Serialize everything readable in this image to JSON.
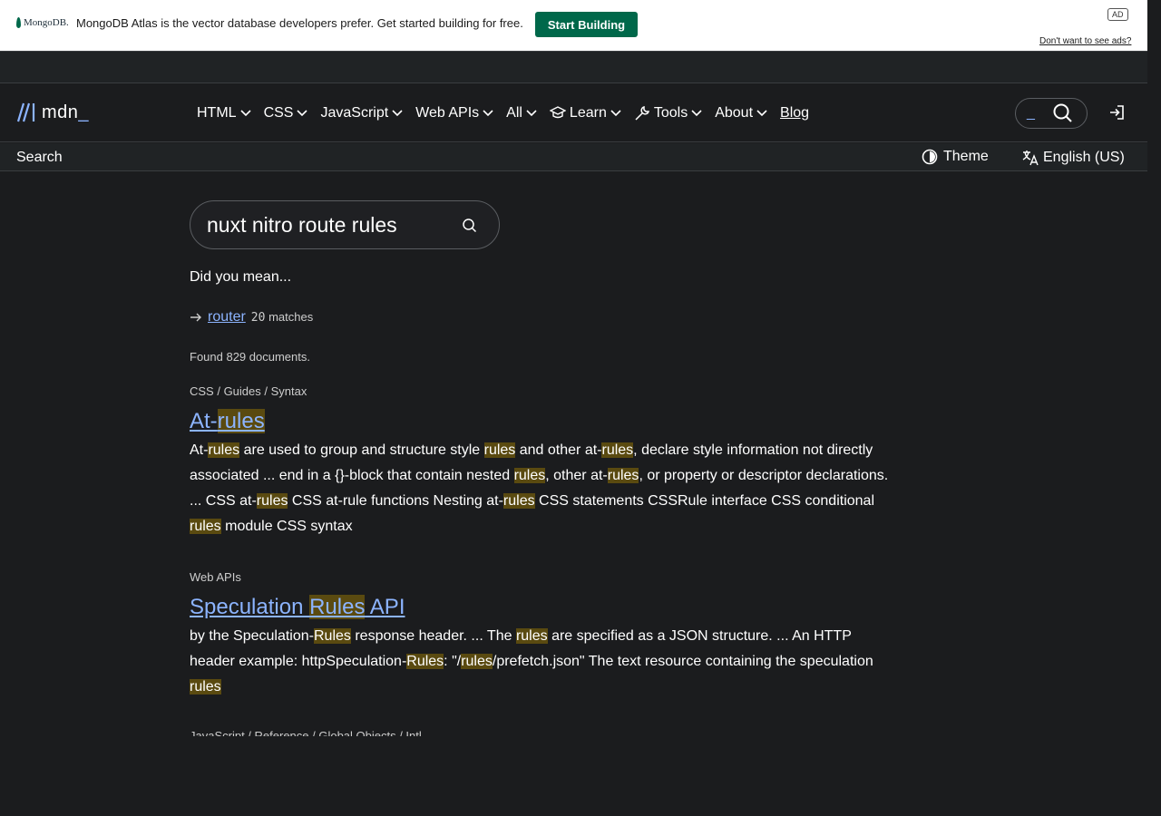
{
  "ad": {
    "logo_text": "MongoDB.",
    "text": "MongoDB Atlas is the vector database developers prefer. Get started building for free.",
    "button_label": "Start Building",
    "badge": "AD",
    "optout": "Don't want to see ads?"
  },
  "nav": {
    "logo_text": "mdn",
    "logo_underscore": "_",
    "items": [
      {
        "label": "HTML"
      },
      {
        "label": "CSS"
      },
      {
        "label": "JavaScript"
      },
      {
        "label": "Web APIs"
      },
      {
        "label": "All"
      },
      {
        "label": "Learn",
        "icon": "graduation-cap-icon"
      },
      {
        "label": "Tools",
        "icon": "wrench-icon"
      },
      {
        "label": "About"
      }
    ],
    "blog": "Blog",
    "search_underscore": "_"
  },
  "subbar": {
    "title": "Search",
    "theme": "Theme",
    "language": "English (US)"
  },
  "search": {
    "query": "nuxt nitro route rules"
  },
  "suggest": {
    "heading": "Did you mean...",
    "term": "router",
    "count": "20",
    "count_suffix": "matches"
  },
  "found": "Found 829 documents.",
  "results": [
    {
      "breadcrumb": "CSS / Guides / Syntax",
      "title_a": "At-",
      "title_hl": "rules",
      "title_b": ""
    },
    {
      "breadcrumb": "Web APIs",
      "title_a": "Speculation ",
      "title_hl": "Rules",
      "title_b": " API"
    }
  ],
  "snippets": {
    "r1": [
      "At-",
      "rules",
      " are used to group and structure style ",
      "rules",
      " and other at-",
      "rules",
      ", declare style information not directly associated ... end in a {}-block that contain nested ",
      "rules",
      ", other at-",
      "rules",
      ", or property or descriptor declarations. ... CSS at-",
      "rules",
      " CSS at-rule functions Nesting at-",
      "rules",
      " CSS statements CSSRule interface CSS conditional ",
      "rules",
      " module CSS syntax"
    ],
    "r2": [
      "by the Speculation-",
      "Rules",
      " response header. ... The ",
      "rules",
      " are specified as a JSON structure. ... An HTTP header example: httpSpeculation-",
      "Rules",
      ": \"/",
      "rules",
      "/prefetch.json\" The text resource containing the speculation ",
      "rules",
      ""
    ]
  },
  "clipped_breadcrumb": "JavaScript / Reference / Global Objects / Intl"
}
